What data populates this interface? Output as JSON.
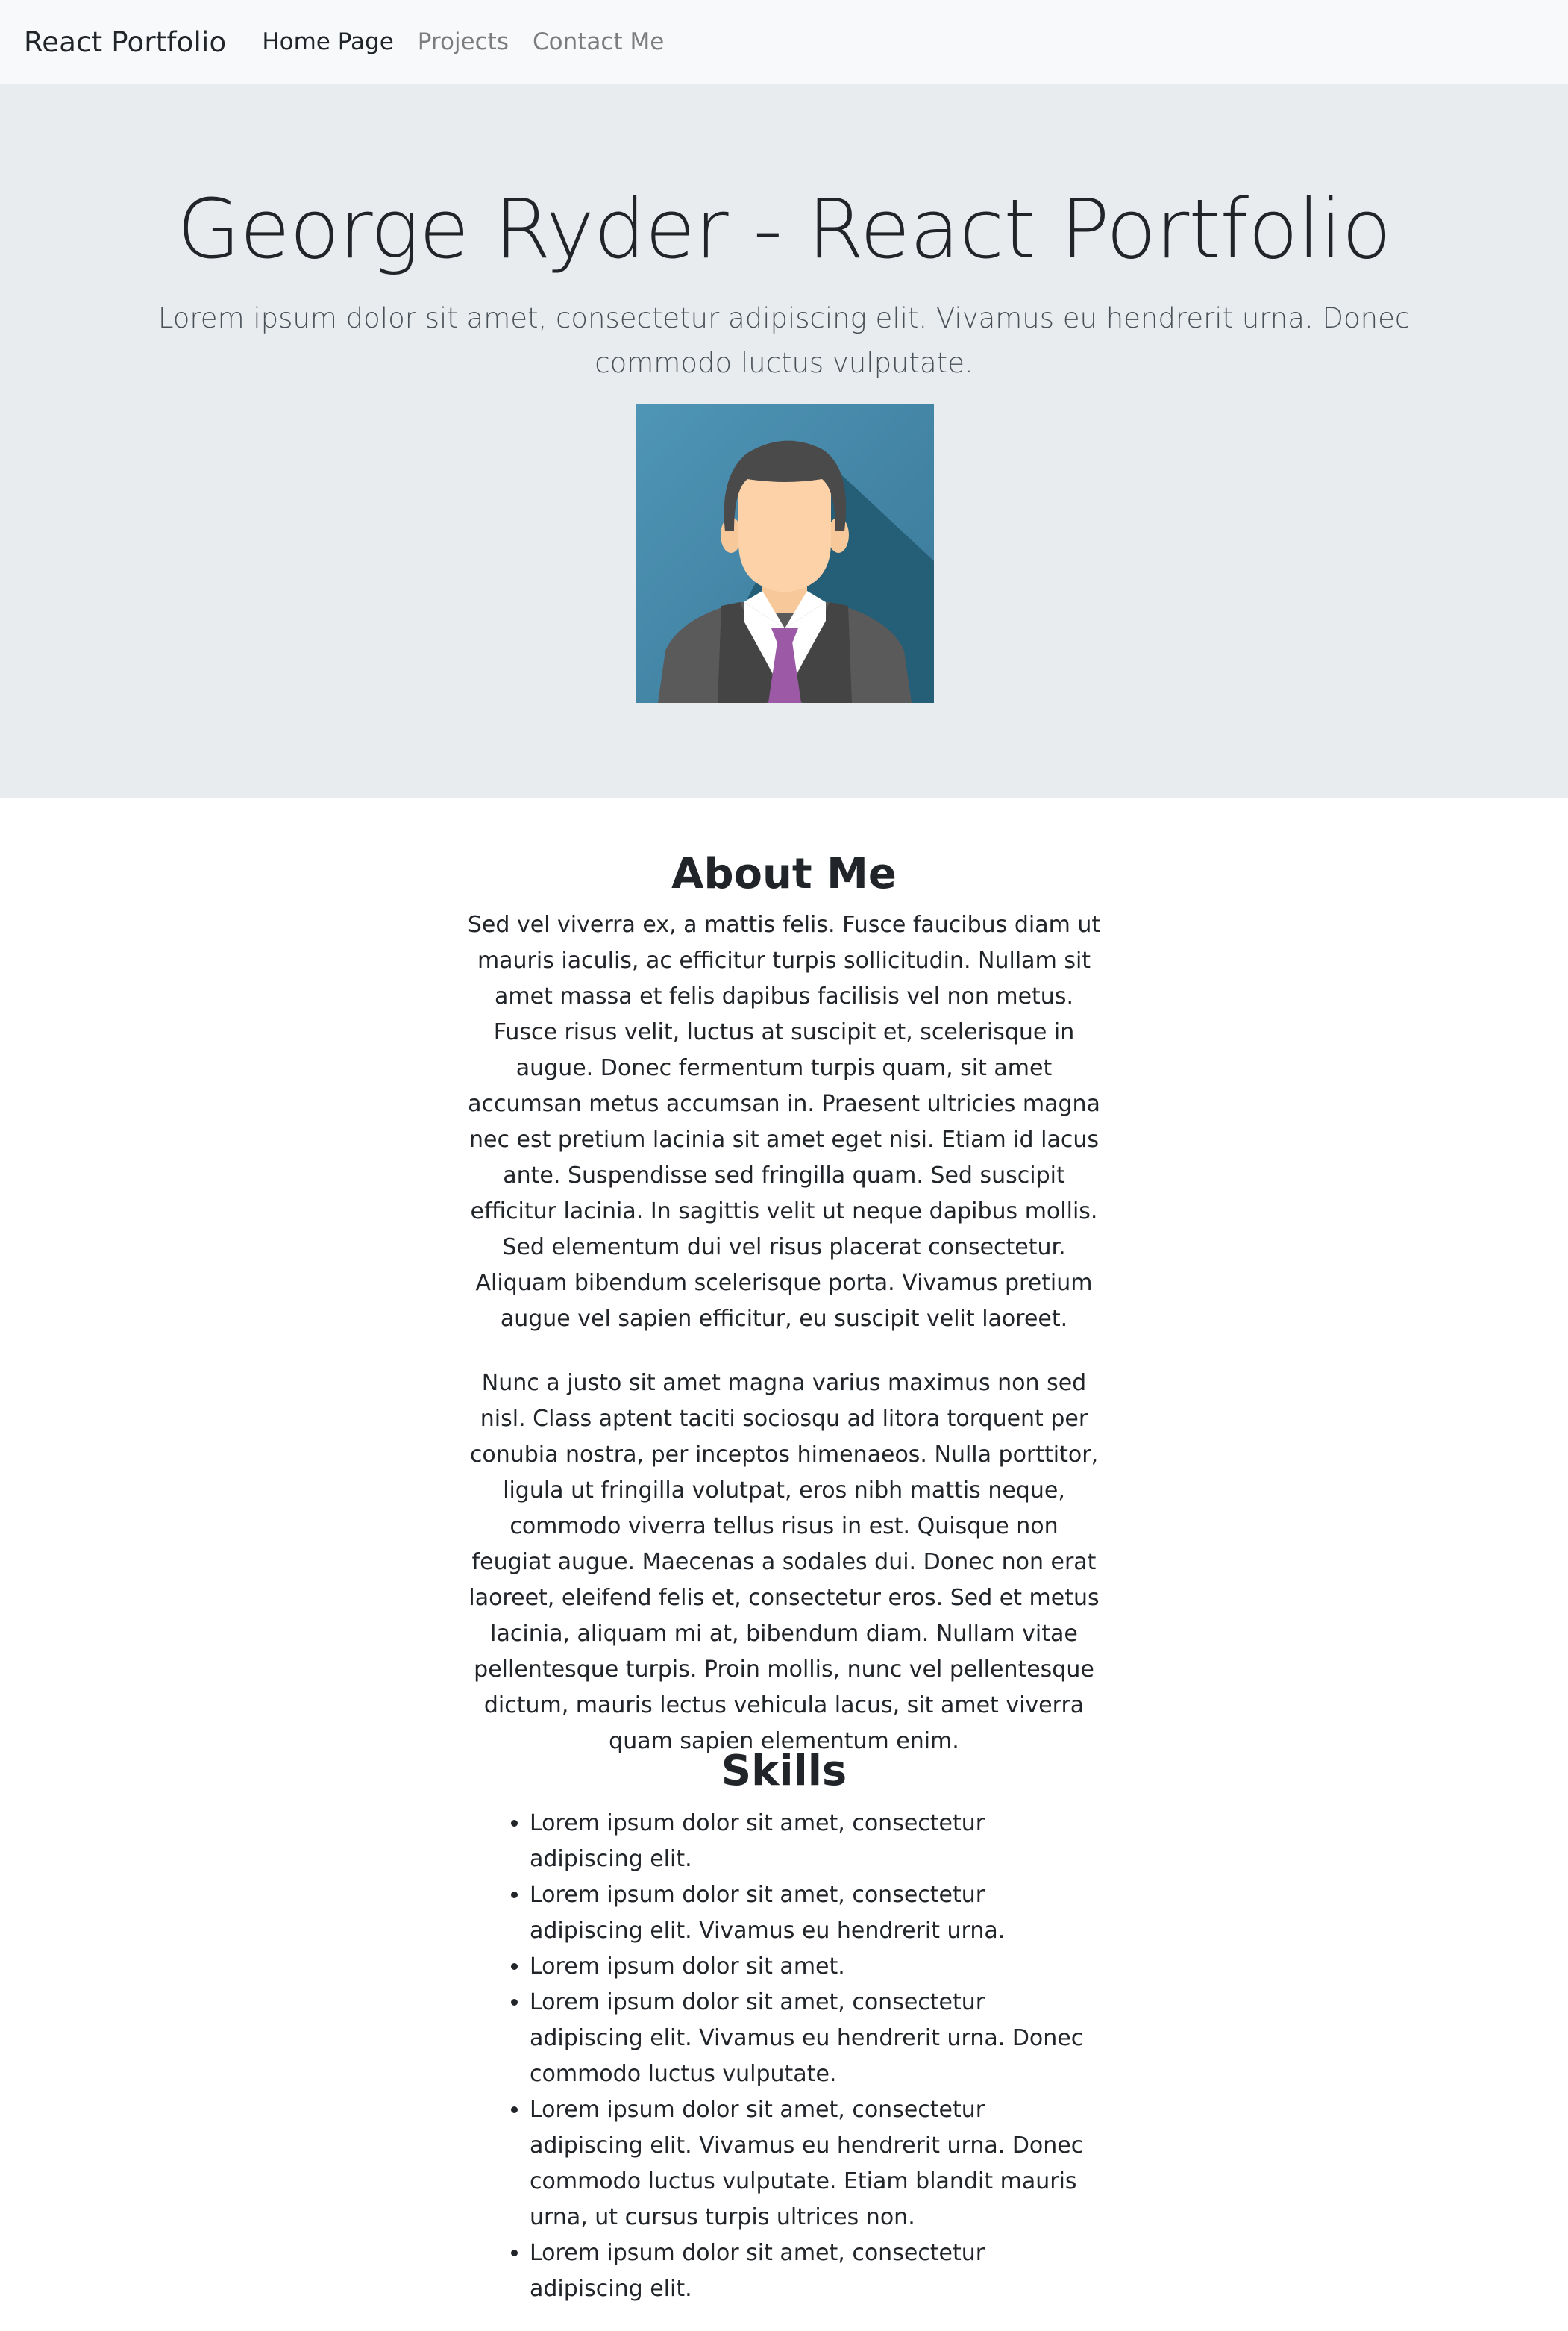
{
  "navbar": {
    "brand": "React Portfolio",
    "links": [
      {
        "label": "Home Page",
        "active": true
      },
      {
        "label": "Projects",
        "active": false
      },
      {
        "label": "Contact Me",
        "active": false
      }
    ]
  },
  "hero": {
    "title": "George Ryder - React Portfolio",
    "lead": "Lorem ipsum dolor sit amet, consectetur adipiscing elit. Vivamus eu hendrerit urna. Donec commodo luctus vulputate.",
    "background": "#e9ecef"
  },
  "about": {
    "heading": "About Me",
    "paragraphs": [
      "Sed vel viverra ex, a mattis felis. Fusce faucibus diam ut mauris iaculis, ac efficitur turpis sollicitudin. Nullam sit amet massa et felis dapibus facilisis vel non metus. Fusce risus velit, luctus at suscipit et, scelerisque in augue. Donec fermentum turpis quam, sit amet accumsan metus accumsan in. Praesent ultricies magna nec est pretium lacinia sit amet eget nisi. Etiam id lacus ante. Suspendisse sed fringilla quam. Sed suscipit efficitur lacinia. In sagittis velit ut neque dapibus mollis. Sed elementum dui vel risus placerat consectetur. Aliquam bibendum scelerisque porta. Vivamus pretium augue vel sapien efficitur, eu suscipit velit laoreet.",
      "Nunc a justo sit amet magna varius maximus non sed nisl. Class aptent taciti sociosqu ad litora torquent per conubia nostra, per inceptos himenaeos. Nulla porttitor, ligula ut fringilla volutpat, eros nibh mattis neque, commodo viverra tellus risus in est. Quisque non feugiat augue. Maecenas a sodales dui. Donec non erat laoreet, eleifend felis et, consectetur eros. Sed et metus lacinia, aliquam mi at, bibendum diam. Nullam vitae pellentesque turpis. Proin mollis, nunc vel pellentesque dictum, mauris lectus vehicula lacus, sit amet viverra quam sapien elementum enim."
    ]
  },
  "skills": {
    "heading": "Skills",
    "items": [
      "Lorem ipsum dolor sit amet, consectetur adipiscing elit.",
      "Lorem ipsum dolor sit amet, consectetur adipiscing elit. Vivamus eu hendrerit urna.",
      "Lorem ipsum dolor sit amet.",
      "Lorem ipsum dolor sit amet, consectetur adipiscing elit. Vivamus eu hendrerit urna. Donec commodo luctus vulputate.",
      "Lorem ipsum dolor sit amet, consectetur adipiscing elit. Vivamus eu hendrerit urna. Donec commodo luctus vulputate. Etiam blandit mauris urna, ut cursus turpis ultrices non.",
      "Lorem ipsum dolor sit amet, consectetur adipiscing elit."
    ]
  },
  "icons": {
    "avatar": "businessman-avatar-icon"
  },
  "colors": {
    "navbar_bg": "#f8f9fa",
    "text": "#212529",
    "muted_link": "#808080",
    "avatar_bg": "#4a8cb0",
    "tie": "#9b59a6"
  }
}
